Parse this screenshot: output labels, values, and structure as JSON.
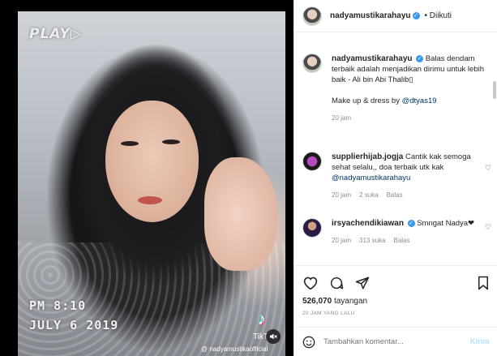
{
  "video": {
    "osd_play": "PLAY▷",
    "osd_time": "PM 8:10",
    "osd_date": "JULY  6  2019",
    "tiktok_label": "TikT",
    "tiktok_handle": "@ nadyamustikaofficial"
  },
  "header": {
    "username": "nadyamustikarahayu",
    "follow_status": "• Diikuti"
  },
  "caption": {
    "username": "nadyamustikarahayu",
    "text": "Balas dendam terbaik adalah menjadikan dirimu untuk lebih baik - Ali bin Abi Thalib",
    "credit_prefix": "Make up & dress by ",
    "credit_mention": "@dtyas19",
    "time": "20 jam"
  },
  "comments": [
    {
      "username": "supplierhijab.jogja",
      "text": "Cantik kak  semoga sehat selalu,, doa terbaik utk kak ",
      "mention": "@nadyamustikarahayu",
      "time": "20 jam",
      "likes": "2 suka",
      "reply": "Balas"
    },
    {
      "username": "irsyachendikiawan",
      "text": "Smngat Nadya❤",
      "time": "20 jam",
      "likes": "313 suka",
      "reply": "Balas"
    }
  ],
  "stats": {
    "views_count": "526,070",
    "views_label": "tayangan",
    "posted": "20 JAM YANG LALU"
  },
  "add_comment": {
    "placeholder": "Tambahkan komentar...",
    "send_label": "Kirim"
  },
  "colors": {
    "verified": "#3897f0",
    "send_disabled": "#b2dffc",
    "mention": "#00376b"
  }
}
